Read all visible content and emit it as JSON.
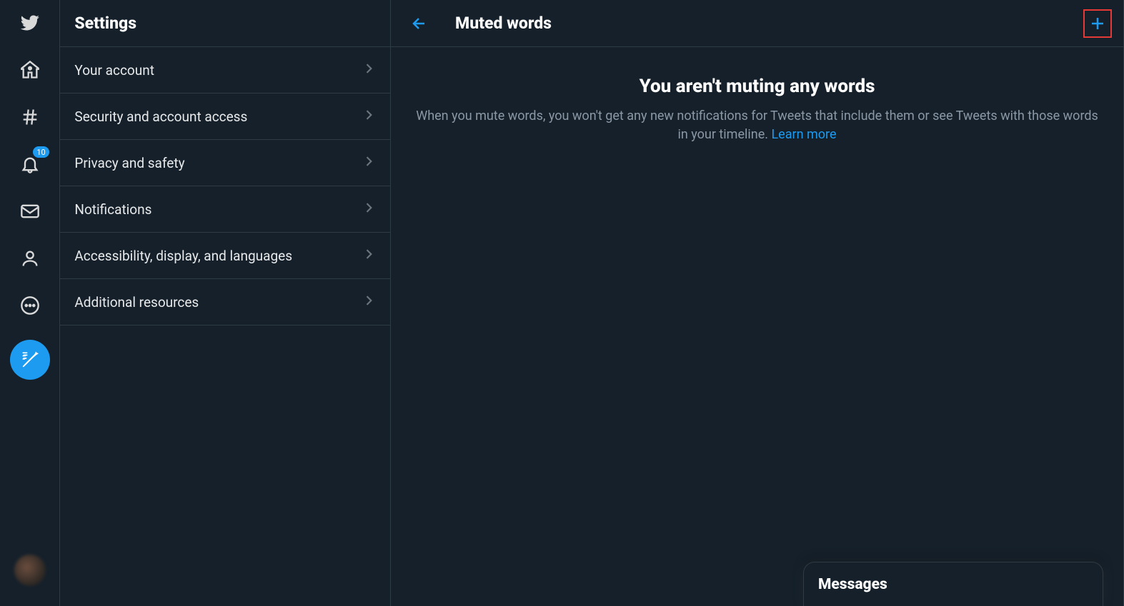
{
  "nav": {
    "notifications_badge": "10"
  },
  "settings": {
    "title": "Settings",
    "items": [
      {
        "label": "Your account"
      },
      {
        "label": "Security and account access"
      },
      {
        "label": "Privacy and safety"
      },
      {
        "label": "Notifications"
      },
      {
        "label": "Accessibility, display, and languages"
      },
      {
        "label": "Additional resources"
      }
    ]
  },
  "detail": {
    "title": "Muted words",
    "empty_heading": "You aren't muting any words",
    "empty_body": "When you mute words, you won't get any new notifications for Tweets that include them or see Tweets with those words in your timeline. ",
    "learn_more": "Learn more"
  },
  "messages": {
    "title": "Messages"
  }
}
